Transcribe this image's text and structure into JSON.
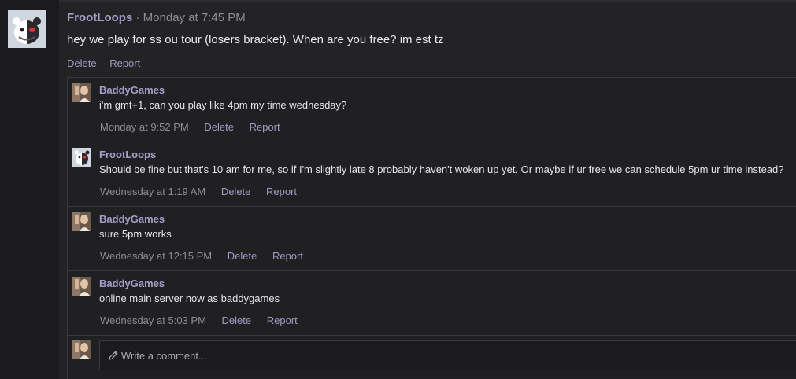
{
  "post": {
    "author": "FrootLoops",
    "separator": "·",
    "timestamp": "Monday at 7:45 PM",
    "body": "hey we play for ss ou tour (losers bracket). When are you free? im est tz",
    "actions": {
      "delete": "Delete",
      "report": "Report"
    },
    "avatar_icon": "monokuma-bear-avatar"
  },
  "comments": [
    {
      "author": "BaddyGames",
      "text": "i'm gmt+1, can you play like 4pm my time wednesday?",
      "timestamp": "Monday at 9:52 PM",
      "delete": "Delete",
      "report": "Report"
    },
    {
      "author": "FrootLoops",
      "text": "Should be fine but that's 10 am for me, so if I'm slightly late 8 probably haven't woken up yet. Or maybe if ur free we can schedule 5pm ur time instead?",
      "timestamp": "Wednesday at 1:19 AM",
      "delete": "Delete",
      "report": "Report"
    },
    {
      "author": "BaddyGames",
      "text": "sure 5pm works",
      "timestamp": "Wednesday at 12:15 PM",
      "delete": "Delete",
      "report": "Report"
    },
    {
      "author": "BaddyGames",
      "text": "online main server now as baddygames",
      "timestamp": "Wednesday at 5:03 PM",
      "delete": "Delete",
      "report": "Report"
    }
  ],
  "composer": {
    "placeholder": "Write a comment...",
    "icon": "pencil-icon"
  },
  "colors": {
    "author": "#a69cc9",
    "link": "#a09bc4",
    "muted": "#8e8e93",
    "text": "#e6e6e8",
    "background": "#232325"
  }
}
